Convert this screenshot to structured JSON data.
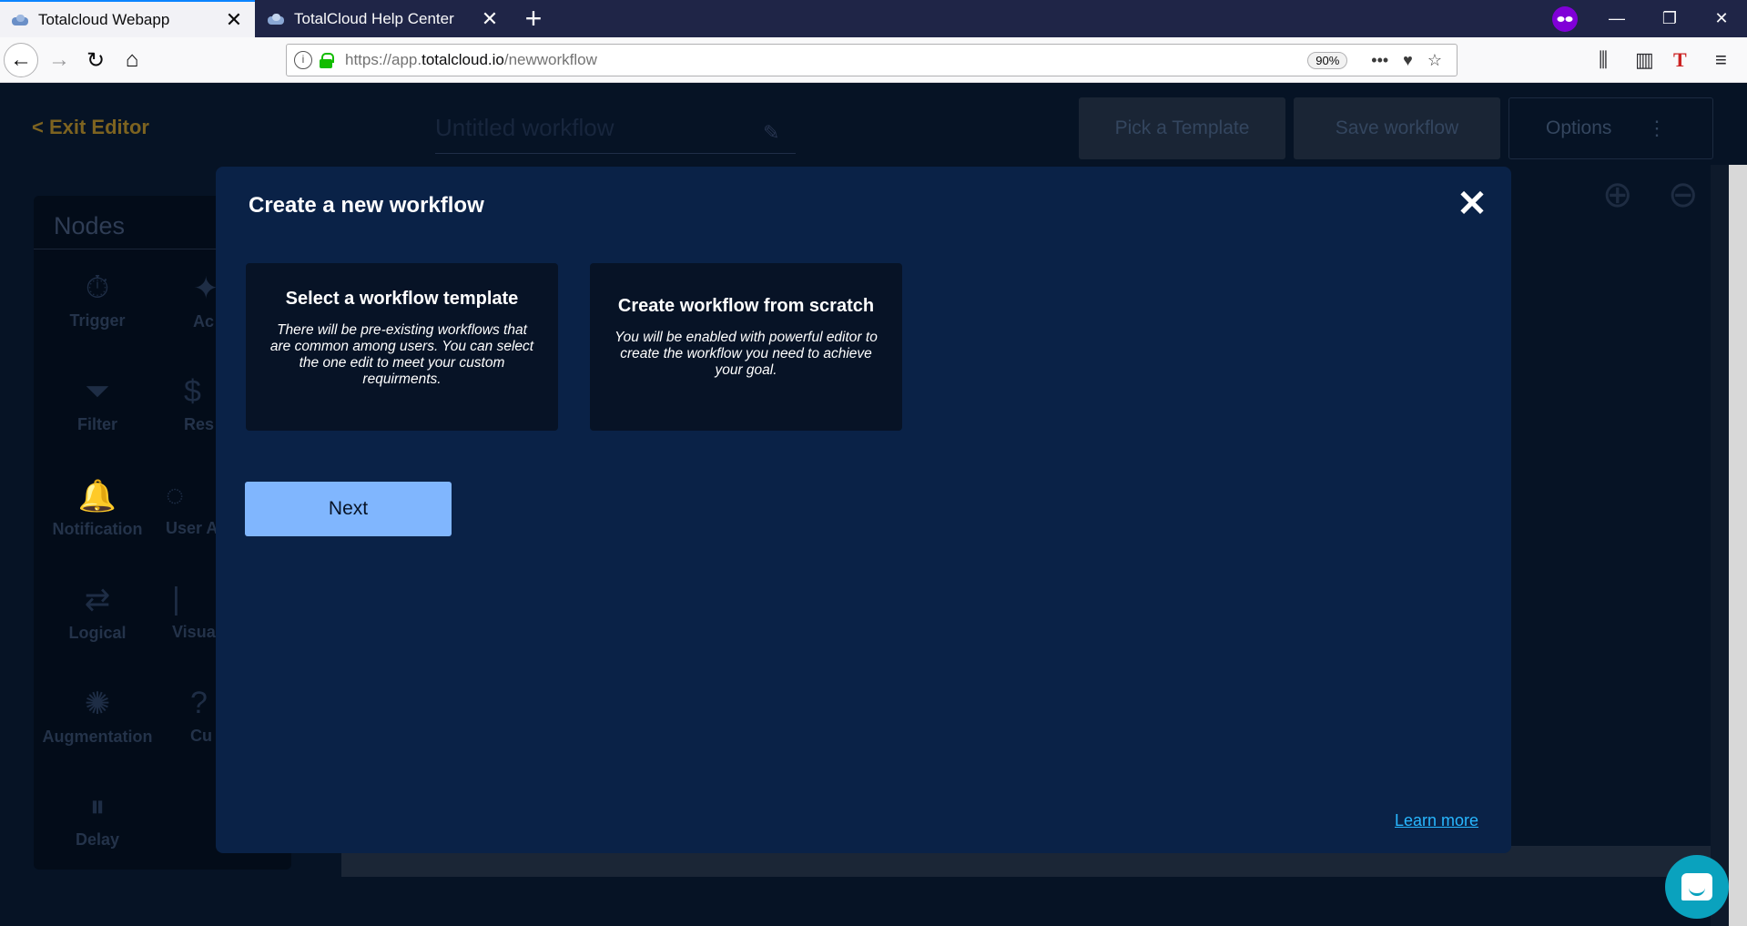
{
  "browser": {
    "tabs": [
      {
        "title": "Totalcloud Webapp",
        "close": "✕"
      },
      {
        "title": "TotalCloud Help Center",
        "close": "✕"
      }
    ],
    "new_tab": "+",
    "url": {
      "prefix": "https://app.",
      "domain": "totalcloud.io",
      "path": "/newworkflow"
    },
    "zoom": "90%",
    "window_controls": {
      "minimize": "—",
      "restore": "❐",
      "close": "✕"
    },
    "nav": {
      "back": "←",
      "forward": "→",
      "reload": "↻",
      "home": "⌂"
    },
    "url_icons": {
      "info": "i",
      "more": "•••",
      "pocket": "♥",
      "bookmark": "☆"
    },
    "toolbar": {
      "library": "⫼",
      "sidebar": "▥",
      "extension": "T",
      "menu": "≡"
    }
  },
  "app": {
    "exit_label": "< Exit Editor",
    "workflow_title_placeholder": "Untitled workflow",
    "pencil": "✎",
    "buttons": {
      "template": "Pick a Template",
      "save": "Save workflow",
      "options": "Options",
      "kebab": "⋮"
    },
    "nodes": {
      "title": "Nodes",
      "items": [
        {
          "label": "Trigger",
          "icon": "⏱"
        },
        {
          "label": "Ac",
          "icon": "✦"
        },
        {
          "label": "Filter",
          "icon": "⏷"
        },
        {
          "label": "Res",
          "icon": "$"
        },
        {
          "label": "Notification",
          "icon": "🔔"
        },
        {
          "label": "User A",
          "icon": "◌"
        },
        {
          "label": "Logical",
          "icon": "⇄"
        },
        {
          "label": "Visua",
          "icon": "|"
        },
        {
          "label": "Augmentation",
          "icon": "✺"
        },
        {
          "label": "Cu",
          "icon": "?"
        },
        {
          "label": "Delay",
          "icon": "⏸"
        }
      ]
    },
    "zoom_in": "⊕",
    "zoom_out": "⊖"
  },
  "modal": {
    "title": "Create a new workflow",
    "close": "✕",
    "cards": [
      {
        "title": "Select a workflow template",
        "description": "There will be pre-existing workflows that are common among users. You can select the one edit to meet your custom requirments."
      },
      {
        "title": "Create workflow from scratch",
        "description": "You will be enabled with powerful editor to create the workflow you need to achieve your goal."
      }
    ],
    "next_label": "Next",
    "learn_more": "Learn more"
  },
  "colors": {
    "modal_bg": "#0a2247",
    "card_bg": "#071326",
    "next_button": "#80b6fe",
    "link": "#28b7ff"
  }
}
